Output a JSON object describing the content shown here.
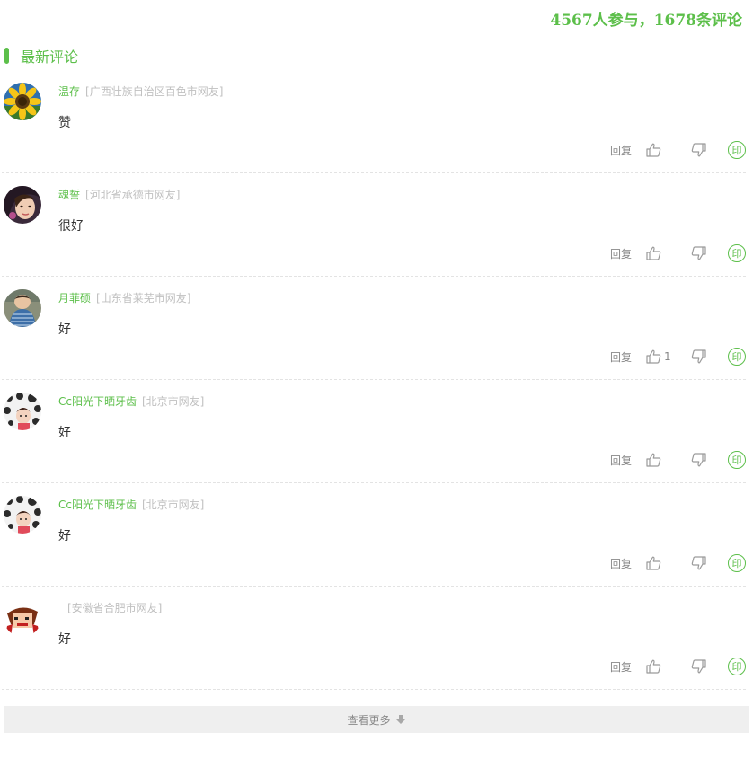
{
  "summary": "4567人参与，1678条评论",
  "section": {
    "title": "最新评论"
  },
  "comments": [
    {
      "user": "温存",
      "location": "[广西壮族自治区百色市网友]",
      "content": "赞",
      "reply": "回复",
      "likes": "",
      "avatar": "sunflower"
    },
    {
      "user": "魂誓",
      "location": "[河北省承德市网友]",
      "content": "很好",
      "reply": "回复",
      "likes": "",
      "avatar": "girl"
    },
    {
      "user": "月菲硕",
      "location": "[山东省莱芜市网友]",
      "content": "好",
      "reply": "回复",
      "likes": "1",
      "avatar": "child"
    },
    {
      "user": "Cc阳光下晒牙齿",
      "location": "[北京市网友]",
      "content": "好",
      "reply": "回复",
      "likes": "",
      "avatar": "polka"
    },
    {
      "user": "Cc阳光下晒牙齿",
      "location": "[北京市网友]",
      "content": "好",
      "reply": "回复",
      "likes": "",
      "avatar": "polka"
    },
    {
      "user": "",
      "location": "[安徽省合肥市网友]",
      "content": "好",
      "reply": "回复",
      "likes": "",
      "avatar": "cartoon"
    }
  ],
  "print_glyph": "印",
  "more": {
    "label": "查看更多"
  },
  "colors": {
    "accent": "#5cbf4a",
    "muted": "#888888",
    "location": "#c0c0c0"
  }
}
